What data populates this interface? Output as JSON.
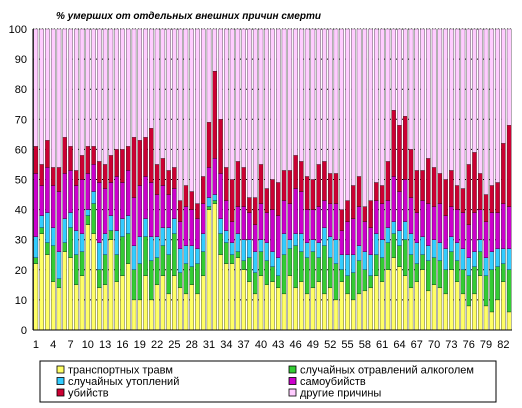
{
  "chart_data": {
    "type": "bar",
    "stacked": true,
    "title": "% умерших  от отдельных внешних причин смерти",
    "xlabel": "",
    "ylabel": "",
    "ylim": [
      0,
      100
    ],
    "yticks": [
      0,
      10,
      20,
      30,
      40,
      50,
      60,
      70,
      80,
      90,
      100
    ],
    "x": [
      1,
      2,
      3,
      4,
      5,
      6,
      7,
      8,
      9,
      10,
      11,
      12,
      13,
      14,
      15,
      16,
      17,
      18,
      19,
      20,
      21,
      22,
      23,
      24,
      25,
      26,
      27,
      28,
      29,
      30,
      31,
      32,
      33,
      34,
      35,
      36,
      37,
      38,
      39,
      40,
      41,
      42,
      43,
      44,
      45,
      46,
      47,
      48,
      49,
      50,
      51,
      52,
      53,
      54,
      55,
      56,
      57,
      58,
      59,
      60,
      61,
      62,
      63,
      64,
      65,
      66,
      67,
      68,
      69,
      70,
      71,
      72,
      73,
      74,
      75,
      76,
      77,
      78,
      79,
      80,
      81,
      82,
      83
    ],
    "xtick_labels": [
      "1",
      "4",
      "7",
      "10",
      "13",
      "16",
      "19",
      "22",
      "25",
      "28",
      "31",
      "34",
      "37",
      "40",
      "43",
      "46",
      "49",
      "52",
      "55",
      "58",
      "61",
      "64",
      "67",
      "70",
      "73",
      "76",
      "79",
      "82"
    ],
    "grid": "horizontal dotted",
    "legend_position": "bottom",
    "series": [
      {
        "name": "транспортных травм",
        "color": "#ffff66",
        "values": [
          22,
          32,
          25,
          16,
          14,
          26,
          24,
          15,
          18,
          35,
          32,
          14,
          15,
          30,
          16,
          18,
          22,
          10,
          10,
          18,
          10,
          15,
          18,
          12,
          18,
          14,
          12,
          15,
          12,
          18,
          40,
          42,
          25,
          22,
          22,
          24,
          20,
          16,
          12,
          18,
          15,
          16,
          14,
          12,
          18,
          14,
          16,
          12,
          14,
          16,
          12,
          14,
          10,
          16,
          12,
          10,
          12,
          13,
          14,
          18,
          16,
          20,
          24,
          21,
          18,
          14,
          16,
          20,
          13,
          15,
          14,
          12,
          20,
          16,
          12,
          8,
          12,
          18,
          8,
          6,
          10,
          16,
          6
        ]
      },
      {
        "name": "случайных отравлений алкоголем",
        "color": "#33cc33",
        "values": [
          2,
          2,
          4,
          12,
          3,
          3,
          10,
          10,
          8,
          3,
          10,
          6,
          10,
          3,
          9,
          13,
          10,
          10,
          12,
          13,
          13,
          9,
          10,
          13,
          14,
          5,
          10,
          6,
          10,
          8,
          1,
          1,
          7,
          7,
          3,
          2,
          3,
          8,
          7,
          8,
          8,
          5,
          4,
          13,
          9,
          14,
          10,
          12,
          12,
          8,
          16,
          10,
          12,
          4,
          6,
          9,
          11,
          7,
          4,
          7,
          8,
          9,
          8,
          7,
          12,
          11,
          6,
          5,
          10,
          9,
          9,
          8,
          6,
          7,
          8,
          10,
          9,
          8,
          10,
          14,
          11,
          6,
          14
        ]
      },
      {
        "name": "случайных утоплений",
        "color": "#33ccff",
        "values": [
          7,
          4,
          10,
          6,
          9,
          8,
          5,
          8,
          6,
          2,
          4,
          9,
          7,
          5,
          8,
          6,
          6,
          8,
          9,
          6,
          8,
          7,
          6,
          9,
          5,
          8,
          6,
          7,
          5,
          6,
          3,
          2,
          5,
          4,
          4,
          6,
          7,
          6,
          7,
          4,
          6,
          5,
          6,
          7,
          3,
          4,
          6,
          5,
          4,
          5,
          6,
          7,
          8,
          5,
          7,
          6,
          5,
          6,
          7,
          7,
          6,
          5,
          4,
          5,
          6,
          7,
          7,
          6,
          5,
          6,
          6,
          7,
          5,
          6,
          7,
          6,
          5,
          4,
          6,
          6,
          6,
          5,
          7
        ]
      },
      {
        "name": "самоубийств",
        "color": "#cc00cc",
        "values": [
          21,
          10,
          15,
          14,
          20,
          15,
          14,
          15,
          18,
          12,
          9,
          20,
          15,
          11,
          18,
          12,
          15,
          16,
          17,
          14,
          18,
          14,
          14,
          11,
          10,
          9,
          13,
          12,
          10,
          10,
          10,
          12,
          15,
          10,
          7,
          9,
          11,
          9,
          9,
          12,
          10,
          14,
          14,
          11,
          12,
          15,
          14,
          11,
          10,
          12,
          9,
          11,
          12,
          8,
          11,
          12,
          13,
          10,
          9,
          11,
          12,
          9,
          15,
          13,
          14,
          12,
          10,
          12,
          14,
          11,
          13,
          11,
          10,
          11,
          12,
          11,
          13,
          10,
          12,
          13,
          12,
          15,
          14
        ]
      },
      {
        "name": "убийств",
        "color": "#cc0033",
        "values": [
          9,
          7,
          9,
          6,
          8,
          12,
          8,
          5,
          8,
          9,
          6,
          7,
          8,
          9,
          9,
          11,
          8,
          20,
          15,
          13,
          18,
          10,
          9,
          8,
          7,
          7,
          7,
          6,
          5,
          9,
          15,
          29,
          18,
          11,
          14,
          15,
          13,
          5,
          9,
          13,
          8,
          10,
          11,
          10,
          11,
          11,
          10,
          11,
          10,
          14,
          13,
          10,
          10,
          7,
          7,
          11,
          10,
          5,
          9,
          6,
          6,
          13,
          22,
          22,
          21,
          16,
          14,
          10,
          15,
          13,
          10,
          12,
          12,
          8,
          8,
          20,
          20,
          12,
          9,
          9,
          10,
          20,
          27
        ]
      },
      {
        "name": "другие причины",
        "color": "#ffccff",
        "values": [
          39,
          45,
          37,
          46,
          46,
          36,
          39,
          47,
          42,
          39,
          39,
          44,
          45,
          42,
          40,
          40,
          39,
          36,
          37,
          36,
          33,
          45,
          43,
          47,
          46,
          57,
          52,
          54,
          58,
          49,
          31,
          14,
          30,
          46,
          50,
          44,
          46,
          56,
          56,
          45,
          53,
          50,
          51,
          47,
          47,
          42,
          44,
          49,
          50,
          45,
          44,
          48,
          48,
          60,
          57,
          52,
          49,
          59,
          57,
          51,
          52,
          44,
          27,
          32,
          29,
          40,
          47,
          47,
          43,
          46,
          48,
          50,
          47,
          52,
          53,
          45,
          41,
          48,
          55,
          52,
          51,
          38,
          32
        ]
      }
    ]
  }
}
